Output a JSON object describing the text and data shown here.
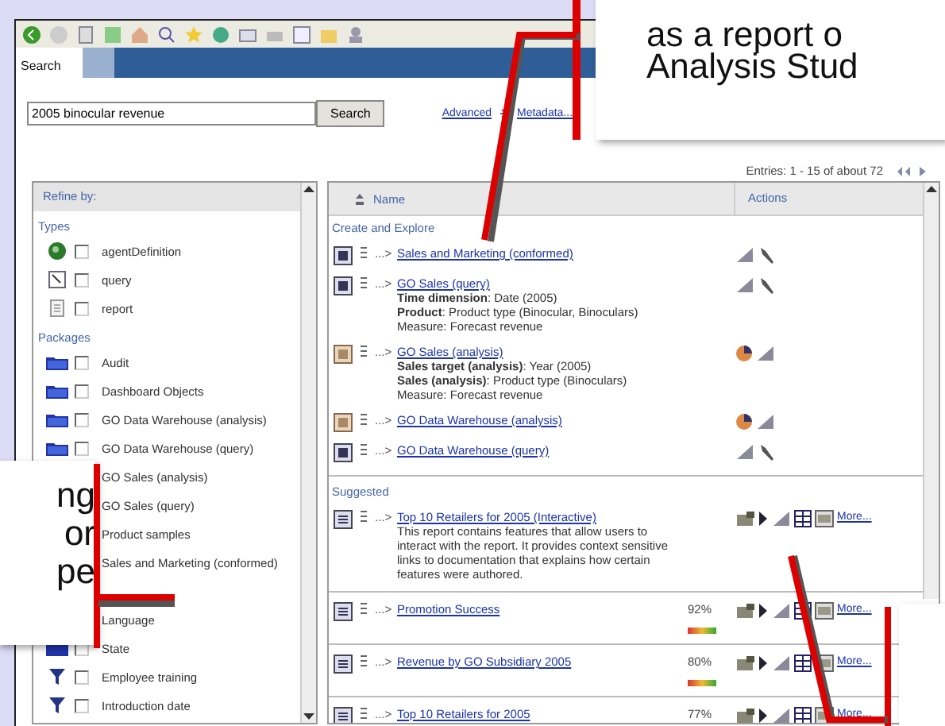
{
  "window": {
    "tab": "Search"
  },
  "search": {
    "value": "2005 binocular revenue",
    "button": "Search",
    "links": [
      "Advanced",
      "Metadata..."
    ]
  },
  "refine": {
    "title": "Refine by:",
    "groups": [
      {
        "label": "Types",
        "items": [
          {
            "label": "agentDefinition",
            "kind": "agent",
            "checked": false
          },
          {
            "label": "query",
            "kind": "query",
            "checked": false
          },
          {
            "label": "report",
            "kind": "report",
            "checked": false
          }
        ]
      },
      {
        "label": "Packages",
        "items": [
          {
            "label": "Audit",
            "kind": "package",
            "checked": false
          },
          {
            "label": "Dashboard Objects",
            "kind": "package",
            "checked": false
          },
          {
            "label": "GO Data Warehouse (analysis)",
            "kind": "package",
            "checked": false
          },
          {
            "label": "GO Data Warehouse (query)",
            "kind": "package",
            "checked": false
          },
          {
            "label": "GO Sales (analysis)"
          },
          {
            "label": "GO Sales (query)"
          },
          {
            "label": "Product samples"
          },
          {
            "label": "Sales and Marketing (conformed)"
          }
        ]
      },
      {
        "items": [
          {
            "label": "Language"
          },
          {
            "label": "State",
            "kind": "dimension",
            "checked": false
          },
          {
            "label": "Employee training",
            "kind": "filter",
            "checked": false
          },
          {
            "label": "Introduction date",
            "kind": "filter",
            "checked": false
          }
        ]
      }
    ]
  },
  "results": {
    "entries": "Entries: 1 - 15 of about 72",
    "columns": [
      "Name",
      "Actions"
    ],
    "sections": [
      {
        "title": "Create and Explore",
        "rows": [
          {
            "kind": "query",
            "arrow": "...>",
            "name": "Sales and Marketing (conformed)"
          },
          {
            "kind": "query",
            "arrow": "...>",
            "name": "GO Sales (query)",
            "details": [
              "**Time dimension**: Date (2005)",
              "**Product**: Product type (Binocular, Binoculars)",
              "Measure: Forecast revenue"
            ]
          },
          {
            "kind": "analysis",
            "arrow": "...>",
            "name": "GO Sales (analysis)",
            "details": [
              "**Sales target (analysis)**: Year (2005)",
              "**Sales (analysis)**: Product type (Binoculars)",
              "Measure: Forecast revenue"
            ]
          },
          {
            "kind": "analysis",
            "arrow": "...>",
            "name": "GO Data Warehouse (analysis)"
          },
          {
            "kind": "query",
            "arrow": "...>",
            "name": "GO Data Warehouse (query)"
          }
        ]
      },
      {
        "title": "Suggested",
        "rows": [
          {
            "kind": "report",
            "arrow": "...>",
            "name": "Top 10 Retailers for 2005 (Interactive)",
            "description": "This report contains features that allow users to interact with the report. It provides context sensitive links to documentation that explains how certain features were authored.",
            "more": "More..."
          },
          {
            "kind": "report",
            "arrow": "...>",
            "name": "Promotion Success",
            "score": "92%",
            "more": "More..."
          },
          {
            "kind": "report",
            "arrow": "...>",
            "name": "Revenue by GO Subsidiary 2005",
            "score": "80%",
            "more": "More..."
          },
          {
            "kind": "report",
            "arrow": "...>",
            "name": "Top 10 Retailers for 2005",
            "score": "77%",
            "more": "More..."
          }
        ]
      }
    ]
  },
  "callouts": [
    {
      "lines": [
        "as a report o",
        "Analysis Stud"
      ]
    },
    {
      "lines": [
        "ng",
        "or",
        "pe"
      ]
    }
  ]
}
